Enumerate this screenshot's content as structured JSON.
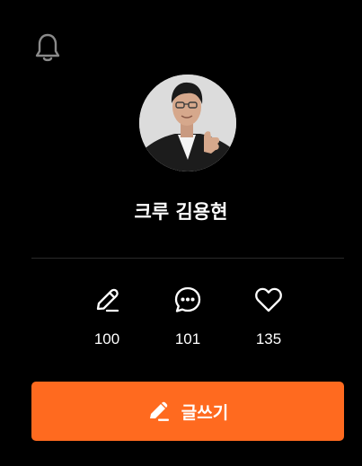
{
  "profile": {
    "name": "크루 김용현"
  },
  "stats": [
    {
      "icon": "pencil-icon",
      "count": "100"
    },
    {
      "icon": "chat-bubble-icon",
      "count": "101"
    },
    {
      "icon": "heart-icon",
      "count": "135"
    }
  ],
  "actions": {
    "write_label": "글쓰기"
  },
  "colors": {
    "background": "#000000",
    "accent": "#ff6a1f",
    "icon_muted": "#8a8a8a",
    "text": "#ffffff"
  }
}
